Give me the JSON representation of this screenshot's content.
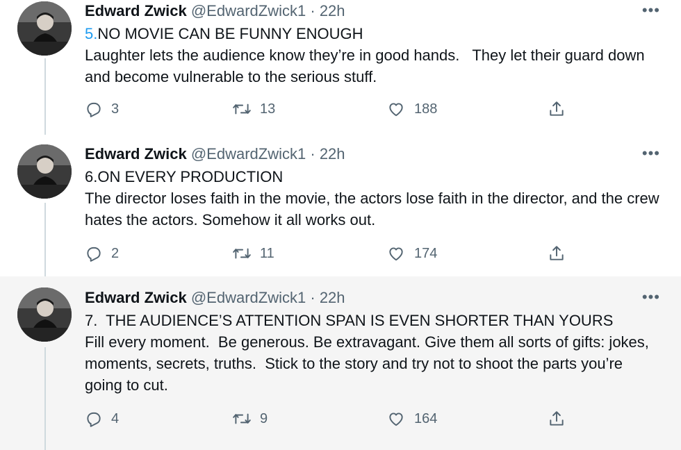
{
  "tweets": [
    {
      "name": "Edward Zwick",
      "handle": "@EdwardZwick1",
      "separator": "·",
      "time": "22h",
      "more": "•••",
      "number": "5.",
      "heading": "NO MOVIE CAN BE FUNNY ENOUGH",
      "body": "Laughter lets the audience know they’re in good hands.   They let their guard down and become vulnerable to the serious stuff.",
      "replies": "3",
      "retweets": "13",
      "likes": "188"
    },
    {
      "name": "Edward Zwick",
      "handle": "@EdwardZwick1",
      "separator": "·",
      "time": "22h",
      "more": "•••",
      "heading": "6.ON EVERY PRODUCTION",
      "body": "The director loses faith in the movie, the actors lose faith in the director, and the crew hates the actors. Somehow it all works out.",
      "replies": "2",
      "retweets": "11",
      "likes": "174"
    },
    {
      "name": "Edward Zwick",
      "handle": "@EdwardZwick1",
      "separator": "·",
      "time": "22h",
      "more": "•••",
      "heading": "7.  THE AUDIENCE’S ATTENTION SPAN IS EVEN SHORTER THAN YOURS",
      "body": "Fill every moment.  Be generous. Be extravagant. Give them all sorts of gifts: jokes, moments, secrets, truths.  Stick to the story and try not to shoot the parts you’re going to cut.",
      "replies": "4",
      "retweets": "9",
      "likes": "164"
    }
  ],
  "icons": {
    "reply": "reply-icon",
    "retweet": "retweet-icon",
    "like": "heart-icon",
    "share": "share-icon",
    "more": "more-icon",
    "avatar": "avatar"
  },
  "colors": {
    "link": "#1d9bf0",
    "secondary": "#536471",
    "thread_line": "#cfd9de",
    "highlight_bg": "#f5f5f5"
  }
}
